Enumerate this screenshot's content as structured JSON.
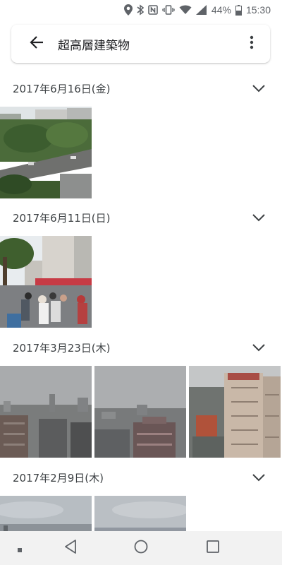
{
  "status_bar": {
    "battery_percent": "44%",
    "time": "15:30",
    "icons": [
      "location-icon",
      "bluetooth-icon",
      "nfc-icon",
      "vibrate-icon",
      "wifi-icon",
      "signal-icon",
      "battery-icon"
    ]
  },
  "search": {
    "title": "超高層建築物",
    "back_icon": "arrow-back-icon",
    "more_icon": "more-vert-icon"
  },
  "sections": [
    {
      "date": "2017年6月16日(金)",
      "photos": [
        "city-street-park"
      ]
    },
    {
      "date": "2017年6月11日(日)",
      "photos": [
        "street-market-crowd"
      ]
    },
    {
      "date": "2017年3月23日(木)",
      "photos": [
        "hazy-skyline-1",
        "hazy-skyline-2",
        "highrise-towers"
      ]
    },
    {
      "date": "2017年2月9日(木)",
      "photos": [
        "cloudy-sky-1",
        "cloudy-sky-2"
      ]
    }
  ],
  "nav": {
    "items": [
      "menu-dot-icon",
      "back-triangle-icon",
      "home-circle-icon",
      "recents-square-icon"
    ]
  },
  "colors": {
    "icon_gray": "#5f6368",
    "text_dark": "#202124",
    "nav_bg": "#f2f2f2"
  }
}
